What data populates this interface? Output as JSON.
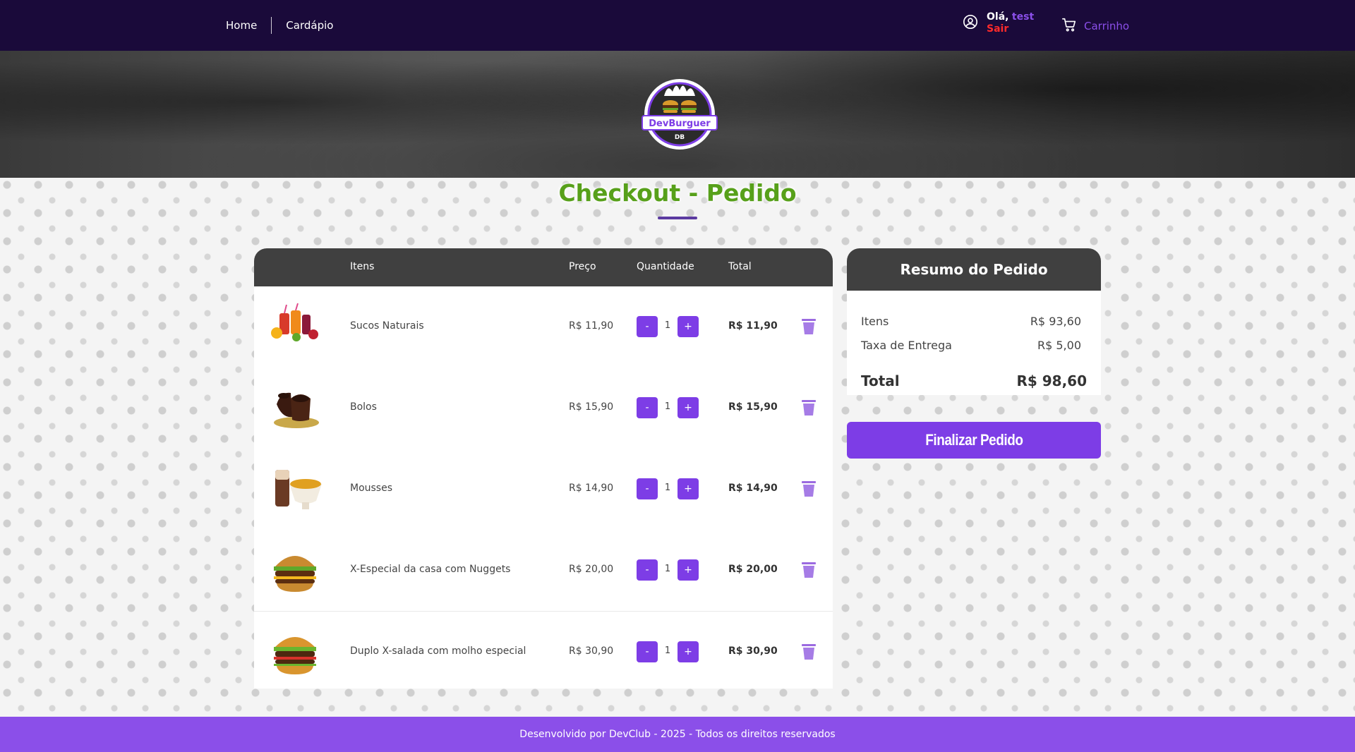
{
  "nav": {
    "home": "Home",
    "menu": "Cardápio",
    "greeting": "Olá,",
    "username": "test",
    "logout": "Sair",
    "cart": "Carrinho"
  },
  "hero": {
    "logo_text": "DevBurguer",
    "logo_sub": "DB"
  },
  "page": {
    "title": "Checkout - Pedido"
  },
  "table": {
    "headers": {
      "items": "Itens",
      "price": "Preço",
      "quantity": "Quantidade",
      "total": "Total"
    },
    "rows": [
      {
        "name": "Sucos Naturais",
        "price": "R$ 11,90",
        "qty": "1",
        "total": "R$ 11,90",
        "image": "juice-icon"
      },
      {
        "name": "Bolos",
        "price": "R$ 15,90",
        "qty": "1",
        "total": "R$ 15,90",
        "image": "cake-icon"
      },
      {
        "name": "Mousses",
        "price": "R$ 14,90",
        "qty": "1",
        "total": "R$ 14,90",
        "image": "mousse-icon"
      },
      {
        "name": "X-Especial da casa com Nuggets",
        "price": "R$ 20,00",
        "qty": "1",
        "total": "R$ 20,00",
        "image": "burger-icon"
      },
      {
        "name": "Duplo X-salada com molho especial",
        "price": "R$ 30,90",
        "qty": "1",
        "total": "R$ 30,90",
        "image": "burger-icon"
      }
    ],
    "minus_label": "-",
    "plus_label": "+"
  },
  "summary": {
    "title": "Resumo do Pedido",
    "items_label": "Itens",
    "items_value": "R$ 93,60",
    "delivery_label": "Taxa de Entrega",
    "delivery_value": "R$ 5,00",
    "total_label": "Total",
    "total_value": "R$ 98,60",
    "finish_label": "Finalizar Pedido"
  },
  "footer": {
    "text": "Desenvolvido por DevClub - 2025 - Todos os direitos reservados"
  },
  "colors": {
    "nav_bg": "#1a0a3a",
    "accent": "#7d3de6",
    "footer_bg": "#8b4fe9",
    "title_green": "#57a01a",
    "logout_red": "#ff2a2a",
    "table_head": "#404040"
  }
}
